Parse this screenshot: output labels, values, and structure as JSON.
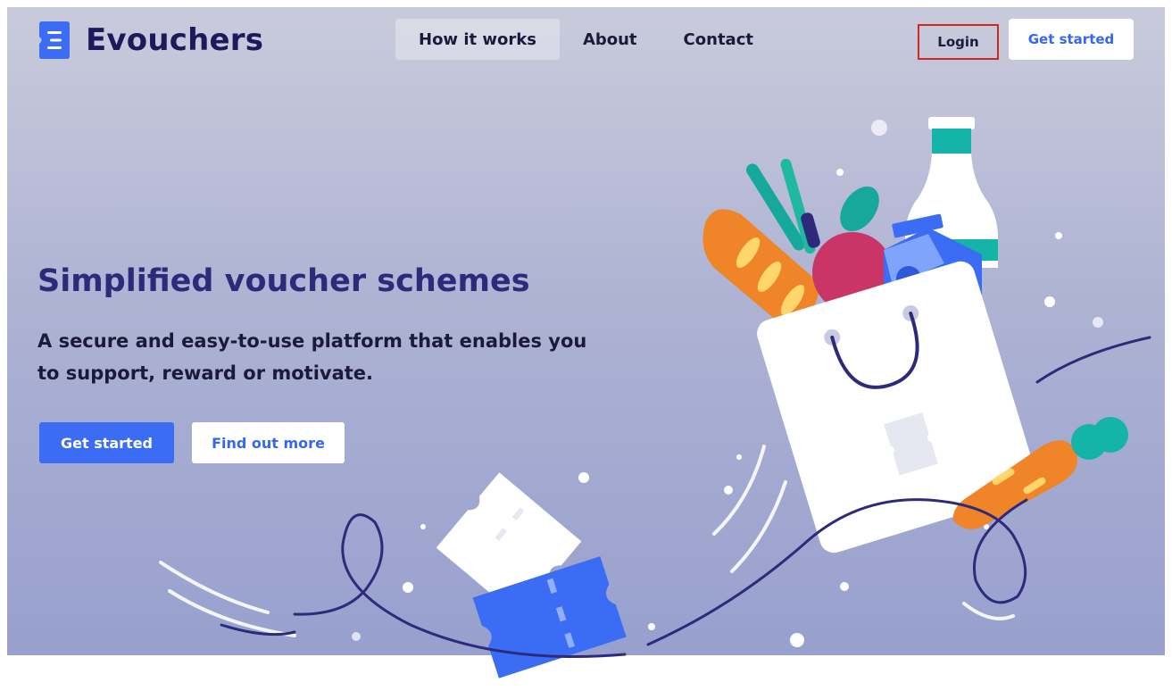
{
  "brand": {
    "name": "Evouchers",
    "icon": "voucher-logo-icon"
  },
  "nav": {
    "items": [
      {
        "label": "How it works",
        "active": true
      },
      {
        "label": "About",
        "active": false
      },
      {
        "label": "Contact",
        "active": false
      }
    ],
    "login_label": "Login",
    "get_started_label": "Get started"
  },
  "hero": {
    "headline": "Simplified voucher schemes",
    "subtitle": "A secure and easy-to-use platform that enables you to support, reward or motivate.",
    "primary_cta": "Get started",
    "secondary_cta": "Find out more"
  },
  "colors": {
    "brand_navy": "#1c1a5a",
    "headline_purple": "#2d2a7c",
    "accent_blue": "#3a6cf4",
    "highlight_red": "#d0281c"
  }
}
